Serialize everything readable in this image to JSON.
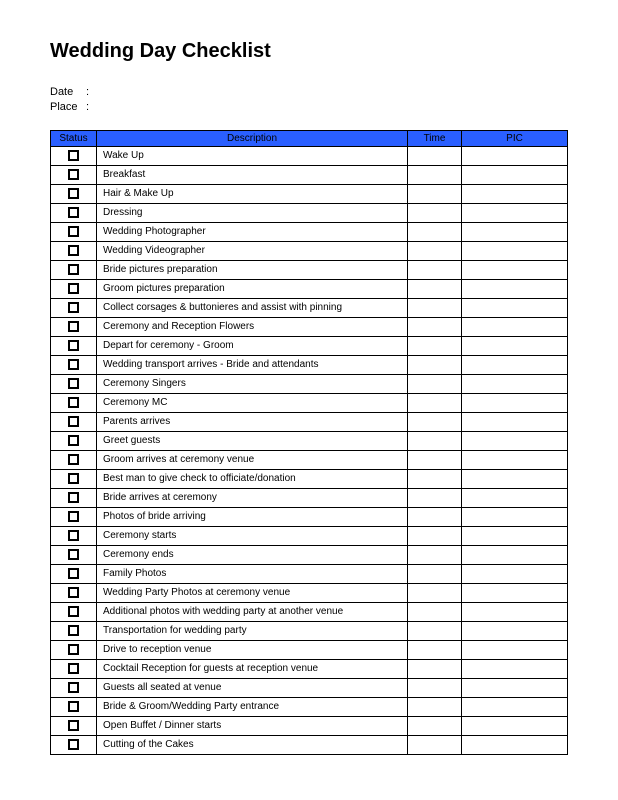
{
  "title": "Wedding Day Checklist",
  "meta": {
    "date_label": "Date",
    "date_value": "",
    "place_label": "Place",
    "place_value": ""
  },
  "headers": {
    "status": "Status",
    "description": "Description",
    "time": "Time",
    "pic": "PIC"
  },
  "items": [
    {
      "description": "Wake Up",
      "time": "",
      "pic": ""
    },
    {
      "description": "Breakfast",
      "time": "",
      "pic": ""
    },
    {
      "description": "Hair & Make Up",
      "time": "",
      "pic": ""
    },
    {
      "description": "Dressing",
      "time": "",
      "pic": ""
    },
    {
      "description": "Wedding Photographer",
      "time": "",
      "pic": ""
    },
    {
      "description": "Wedding Videographer",
      "time": "",
      "pic": ""
    },
    {
      "description": "Bride pictures preparation",
      "time": "",
      "pic": ""
    },
    {
      "description": "Groom pictures preparation",
      "time": "",
      "pic": ""
    },
    {
      "description": "Collect corsages & buttonieres and assist with pinning",
      "time": "",
      "pic": ""
    },
    {
      "description": "Ceremony and Reception Flowers",
      "time": "",
      "pic": ""
    },
    {
      "description": "Depart for ceremony - Groom",
      "time": "",
      "pic": ""
    },
    {
      "description": "Wedding transport arrives - Bride and attendants",
      "time": "",
      "pic": ""
    },
    {
      "description": "Ceremony Singers",
      "time": "",
      "pic": ""
    },
    {
      "description": "Ceremony MC",
      "time": "",
      "pic": ""
    },
    {
      "description": "Parents arrives",
      "time": "",
      "pic": ""
    },
    {
      "description": "Greet guests",
      "time": "",
      "pic": ""
    },
    {
      "description": "Groom arrives at ceremony venue",
      "time": "",
      "pic": ""
    },
    {
      "description": "Best man to give check to officiate/donation",
      "time": "",
      "pic": ""
    },
    {
      "description": "Bride arrives at ceremony",
      "time": "",
      "pic": ""
    },
    {
      "description": "Photos of bride arriving",
      "time": "",
      "pic": ""
    },
    {
      "description": "Ceremony starts",
      "time": "",
      "pic": ""
    },
    {
      "description": "Ceremony ends",
      "time": "",
      "pic": ""
    },
    {
      "description": "Family Photos",
      "time": "",
      "pic": ""
    },
    {
      "description": "Wedding Party Photos at ceremony venue",
      "time": "",
      "pic": ""
    },
    {
      "description": "Additional photos with wedding party at another venue",
      "time": "",
      "pic": ""
    },
    {
      "description": "Transportation for wedding party",
      "time": "",
      "pic": ""
    },
    {
      "description": "Drive to reception venue",
      "time": "",
      "pic": ""
    },
    {
      "description": "Cocktail Reception for guests at reception venue",
      "time": "",
      "pic": ""
    },
    {
      "description": "Guests all seated at venue",
      "time": "",
      "pic": ""
    },
    {
      "description": "Bride & Groom/Wedding Party entrance",
      "time": "",
      "pic": ""
    },
    {
      "description": "Open Buffet / Dinner starts",
      "time": "",
      "pic": ""
    },
    {
      "description": "Cutting of the Cakes",
      "time": "",
      "pic": ""
    }
  ]
}
